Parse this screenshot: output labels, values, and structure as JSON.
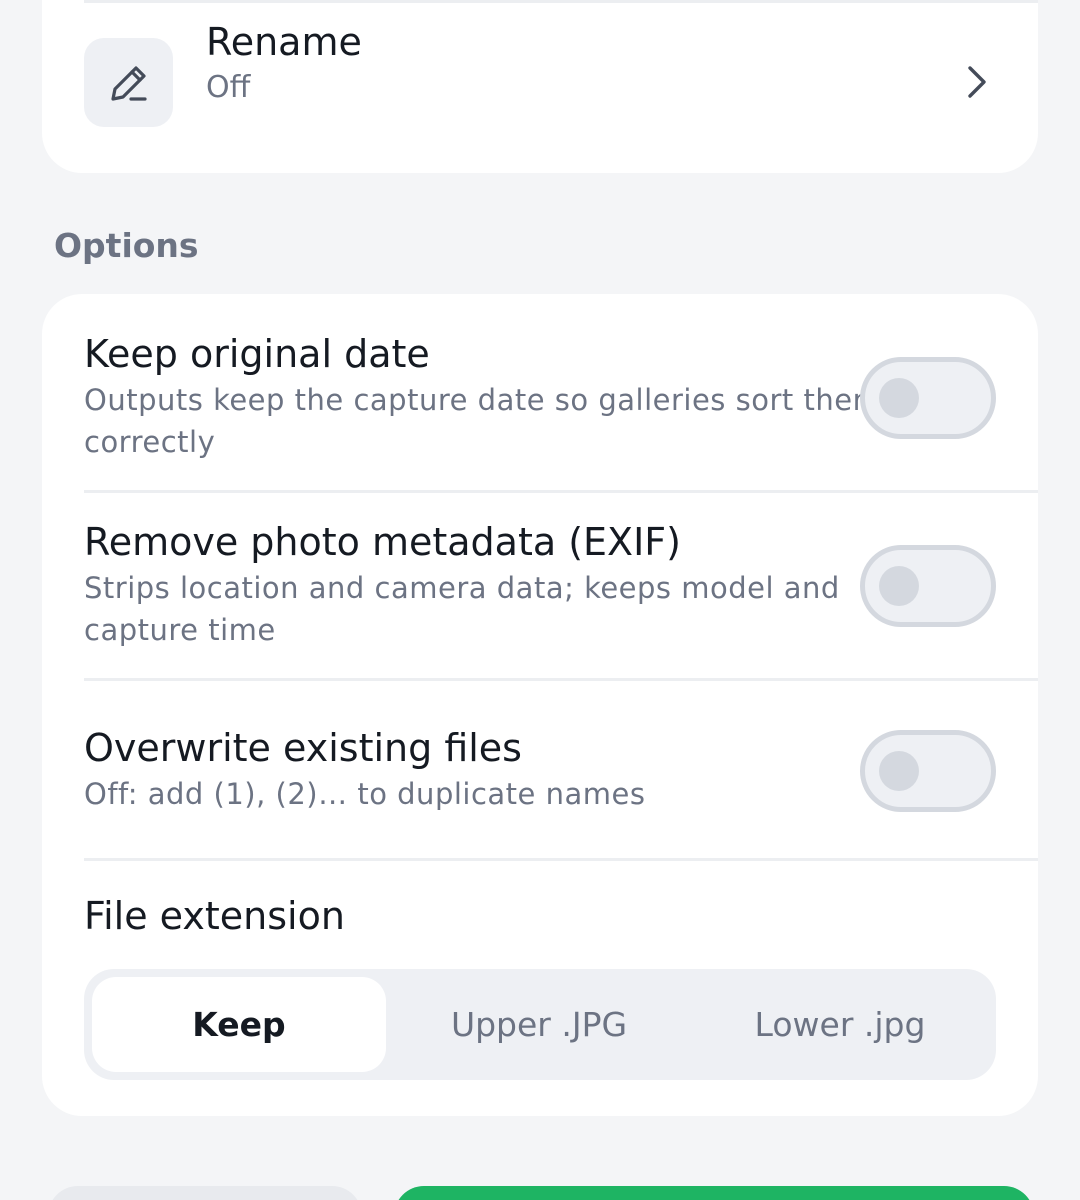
{
  "rename": {
    "title": "Rename",
    "value": "Off",
    "icon": "pencil-icon"
  },
  "options": {
    "header": "Options",
    "keep_date": {
      "title": "Keep original date",
      "desc_line1": "Outputs keep the capture date so galleries sort them",
      "desc_line2": "correctly",
      "enabled": false
    },
    "remove_exif": {
      "title": "Remove photo metadata (EXIF)",
      "desc_line1": "Strips location and camera data; keeps model and",
      "desc_line2": "capture time",
      "enabled": false
    },
    "overwrite": {
      "title": "Overwrite existing files",
      "desc": "Off: add (1), (2)… to duplicate names",
      "enabled": false
    },
    "file_extension": {
      "title": "File extension",
      "options": [
        "Keep",
        "Upper .JPG",
        "Lower .jpg"
      ],
      "selected": "Keep"
    }
  },
  "colors": {
    "accent": "#1eb463",
    "text_primary": "#151a22",
    "text_secondary": "#6c7383",
    "toggle_off": "#d4d8df"
  }
}
